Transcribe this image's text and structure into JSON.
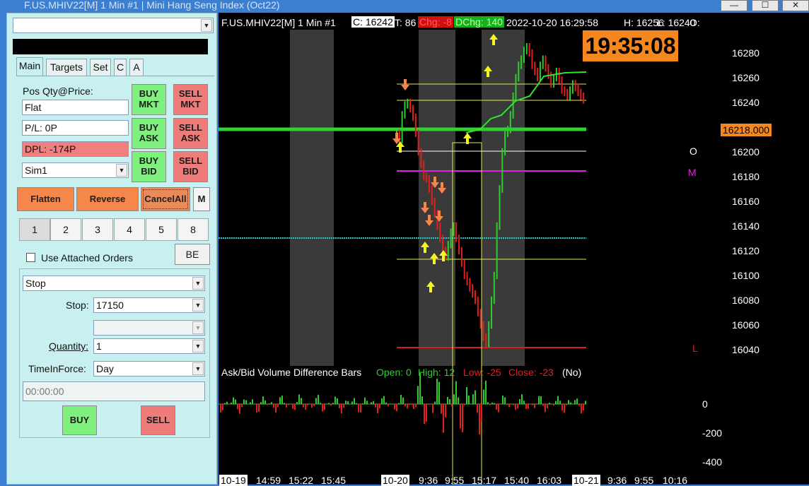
{
  "window": {
    "title": "F.US.MHIV22[M]  1 Min   #1 | Mini Hang Seng Index (Oct22)",
    "min_label": "—",
    "max_label": "☐",
    "close_label": "✕"
  },
  "panel": {
    "account_dropdown": "",
    "tabs": [
      "Main",
      "Targets",
      "Set",
      "C",
      "A"
    ],
    "pos_label": "Pos Qty@Price:",
    "pos_value": "Flat",
    "pl_value": "P/L: 0P",
    "dpl_value": "DPL: -174P",
    "account_value": "Sim1",
    "buy_mkt": [
      "BUY",
      "MKT"
    ],
    "sell_mkt": [
      "SELL",
      "MKT"
    ],
    "buy_ask": [
      "BUY",
      "ASK"
    ],
    "sell_ask": [
      "SELL",
      "ASK"
    ],
    "buy_bid": [
      "BUY",
      "BID"
    ],
    "sell_bid": [
      "SELL",
      "BID"
    ],
    "flatten": "Flatten",
    "reverse": "Reverse",
    "cancel_all": "CancelAll",
    "m_label": "M",
    "qty_buttons": [
      "1",
      "2",
      "3",
      "4",
      "5",
      "8"
    ],
    "attached_orders_label": "Use Attached Orders",
    "be_label": "BE",
    "order_type": "Stop",
    "stop_label": "Stop:",
    "stop_value": "17150",
    "quantity_label": "Quantity:",
    "quantity_value": "1",
    "tif_label": "TimeInForce:",
    "tif_value": "Day",
    "time_value": "00:00:00",
    "buy_label": "BUY",
    "sell_label": "SELL"
  },
  "chart": {
    "header": {
      "symbol": "F.US.MHIV22[M]  1 Min   #1",
      "close": "C: 16242",
      "trades": "T: 86",
      "chg": "Chg: -8",
      "dchg": "DChg: 140",
      "datetime": "2022-10-20  16:29:58",
      "high": "H: 16256",
      "low": "L: 16240",
      "open": "O:"
    },
    "clock": "19:35:08",
    "price_marker": "16218.000",
    "y_labels": [
      "16280",
      "16260",
      "16240",
      "16200",
      "16180",
      "16160",
      "16140",
      "16120",
      "16100",
      "16080",
      "16060",
      "16040"
    ],
    "level_labels": {
      "open": "O",
      "mid": "M",
      "low": "L"
    },
    "indicator": {
      "name": "Ask/Bid Volume Difference Bars",
      "open": "Open: 0",
      "high": "High: 12",
      "low": "Low: -25",
      "close": "Close: -23",
      "note": "(No)"
    },
    "indicator_y_labels": [
      "0",
      "-200",
      "-400"
    ],
    "x_labels": [
      "10-19",
      "14:59",
      "15:22",
      "15:45",
      "10-20",
      "9:36",
      "9:55",
      "15:17",
      "15:40",
      "16:03",
      "10-21",
      "9:36",
      "9:55",
      "10:16"
    ],
    "colors": {
      "background": "#000000",
      "accent_orange": "#f5874a",
      "up": "#2ecc2e",
      "down": "#e02020",
      "session_band": "#3a3a3a"
    }
  }
}
